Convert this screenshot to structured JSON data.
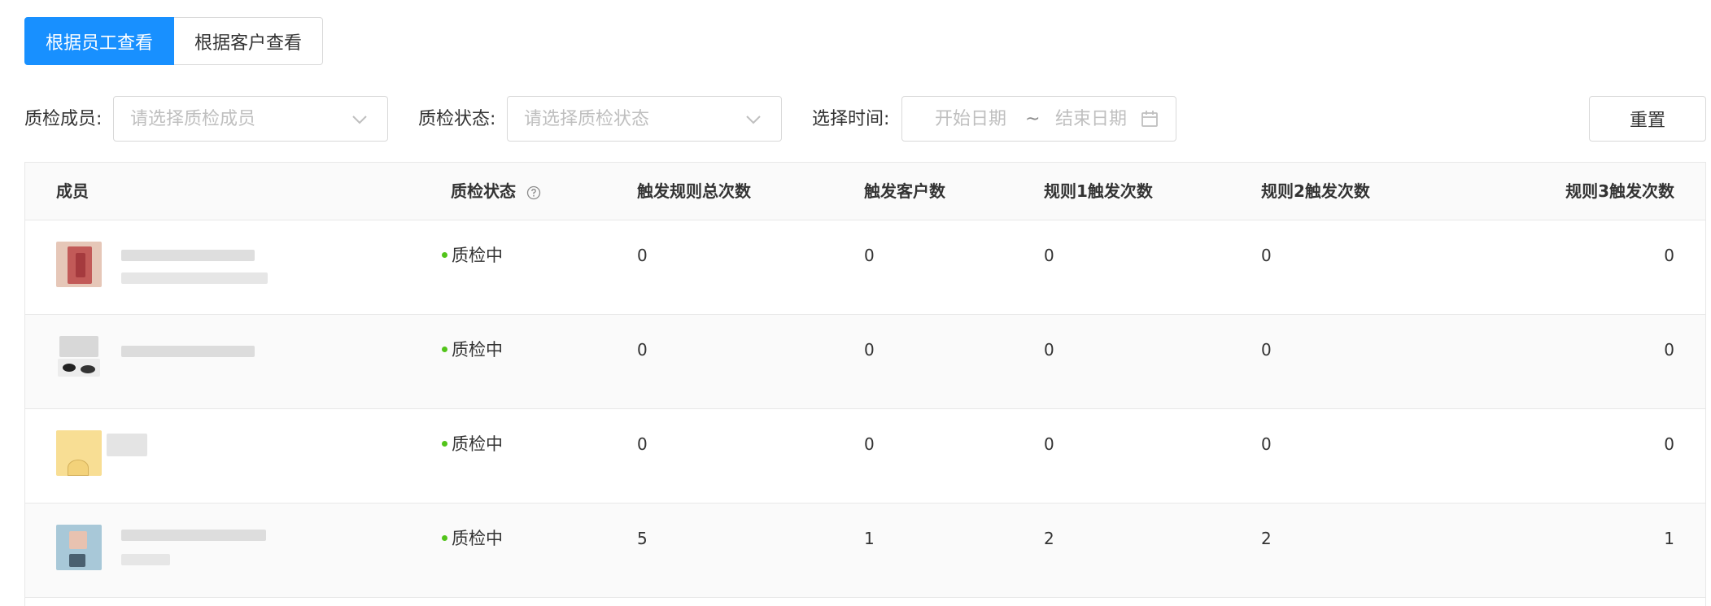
{
  "tabs": [
    {
      "label": "根据员工查看",
      "active": true
    },
    {
      "label": "根据客户查看",
      "active": false
    }
  ],
  "filters": {
    "member_label": "质检成员:",
    "member_placeholder": "请选择质检成员",
    "status_label": "质检状态:",
    "status_placeholder": "请选择质检状态",
    "time_label": "选择时间:",
    "start_placeholder": "开始日期",
    "separator": "~",
    "end_placeholder": "结束日期"
  },
  "reset_label": "重置",
  "table": {
    "headers": [
      "成员",
      "质检状态",
      "触发规则总次数",
      "触发客户数",
      "规则1触发次数",
      "规则2触发次数",
      "规则3触发次数"
    ],
    "rows": [
      {
        "status": "质检中",
        "total": "0",
        "customers": "0",
        "rule1": "0",
        "rule2": "0",
        "rule3": "0"
      },
      {
        "status": "质检中",
        "total": "0",
        "customers": "0",
        "rule1": "0",
        "rule2": "0",
        "rule3": "0"
      },
      {
        "status": "质检中",
        "total": "0",
        "customers": "0",
        "rule1": "0",
        "rule2": "0",
        "rule3": "0"
      },
      {
        "status": "质检中",
        "total": "5",
        "customers": "1",
        "rule1": "2",
        "rule2": "2",
        "rule3": "1"
      }
    ]
  },
  "colors": {
    "primary": "#1890ff",
    "status_dot": "#52c41a",
    "border": "#d9d9d9",
    "placeholder": "#bfbfbf"
  },
  "icons": {
    "select_arrow": "chevron-down-icon",
    "date": "calendar-icon",
    "help": "question-circle-icon"
  }
}
